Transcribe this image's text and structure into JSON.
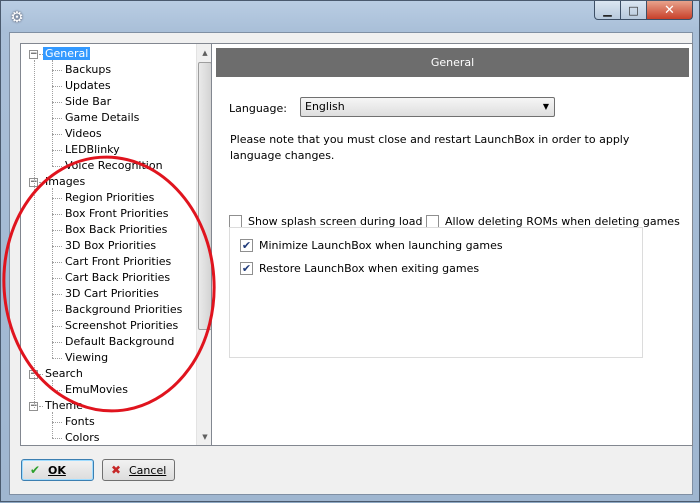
{
  "window": {
    "system_icon": "gear-icon"
  },
  "tree": {
    "items": [
      {
        "label": "General",
        "level": 0,
        "expanded": true,
        "selected": true
      },
      {
        "label": "Backups",
        "level": 1
      },
      {
        "label": "Updates",
        "level": 1
      },
      {
        "label": "Side Bar",
        "level": 1
      },
      {
        "label": "Game Details",
        "level": 1
      },
      {
        "label": "Videos",
        "level": 1
      },
      {
        "label": "LEDBlinky",
        "level": 1
      },
      {
        "label": "Voice Recognition",
        "level": 1
      },
      {
        "label": "Images",
        "level": 0,
        "expanded": true
      },
      {
        "label": "Region Priorities",
        "level": 1
      },
      {
        "label": "Box Front Priorities",
        "level": 1
      },
      {
        "label": "Box Back Priorities",
        "level": 1
      },
      {
        "label": "3D Box Priorities",
        "level": 1
      },
      {
        "label": "Cart Front Priorities",
        "level": 1
      },
      {
        "label": "Cart Back Priorities",
        "level": 1
      },
      {
        "label": "3D Cart Priorities",
        "level": 1
      },
      {
        "label": "Background Priorities",
        "level": 1
      },
      {
        "label": "Screenshot Priorities",
        "level": 1
      },
      {
        "label": "Default Background",
        "level": 1
      },
      {
        "label": "Viewing",
        "level": 1
      },
      {
        "label": "Search",
        "level": 0,
        "expanded": true
      },
      {
        "label": "EmuMovies",
        "level": 1
      },
      {
        "label": "Theme",
        "level": 0,
        "expanded": true
      },
      {
        "label": "Fonts",
        "level": 1
      },
      {
        "label": "Colors",
        "level": 1
      }
    ]
  },
  "panel": {
    "header": "General",
    "language_label": "Language:",
    "language_value": "English",
    "note": "Please note that you must close and restart LaunchBox in order to apply language changes.",
    "checkboxes": {
      "splash": {
        "label": "Show splash screen during load",
        "checked": false
      },
      "delete_roms": {
        "label": "Allow deleting ROMs when deleting games",
        "checked": false
      },
      "minimize": {
        "label": "Minimize LaunchBox when launching games",
        "checked": true
      },
      "restore": {
        "label": "Restore LaunchBox when exiting games",
        "checked": true
      }
    }
  },
  "buttons": {
    "ok": "OK",
    "cancel": "Cancel"
  },
  "colors": {
    "annotation_circle": "#e0141e",
    "selection": "#3399ff",
    "header_bg": "#6d6d6d"
  }
}
